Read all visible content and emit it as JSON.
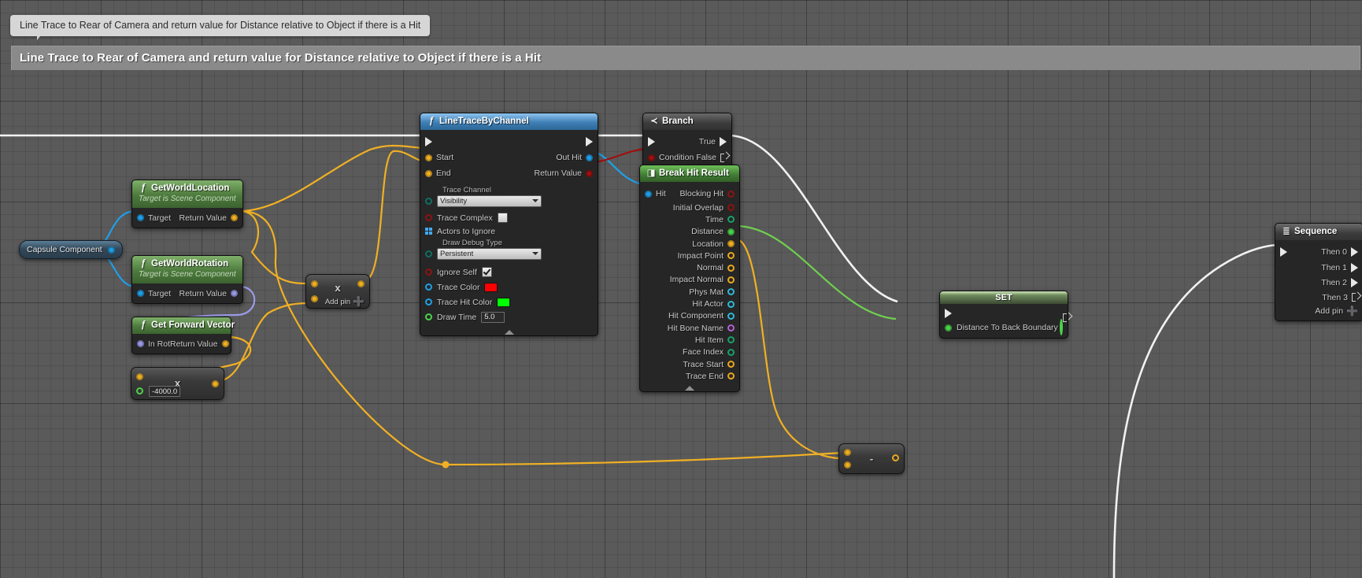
{
  "comment": {
    "bubble_text": "Line Trace to Rear of Camera and return value for Distance relative to Object if there is a Hit",
    "bar_text": "Line Trace to Rear of Camera and return value for Distance relative to Object if there is a Hit"
  },
  "nodes": {
    "capsule": {
      "label": "Capsule Component"
    },
    "get_world_location": {
      "title": "GetWorldLocation",
      "subtitle": "Target is Scene Component",
      "icon": "function-icon",
      "in_target": "Target",
      "out_return": "Return Value"
    },
    "get_world_rotation": {
      "title": "GetWorldRotation",
      "subtitle": "Target is Scene Component",
      "icon": "function-icon",
      "in_target": "Target",
      "out_return": "Return Value"
    },
    "get_forward_vector": {
      "title": "Get Forward Vector",
      "icon": "function-icon",
      "in_rot": "In Rot",
      "out_return": "Return Value"
    },
    "literal_float": {
      "value": "-4000.0",
      "operator": "x"
    },
    "multiply": {
      "operator": "x",
      "add_pin": "Add pin"
    },
    "subtract": {
      "operator": "-"
    },
    "line_trace": {
      "title": "LineTraceByChannel",
      "icon": "function-icon",
      "inputs": {
        "start": "Start",
        "end": "End",
        "trace_channel_label": "Trace Channel",
        "trace_channel_value": "Visibility",
        "trace_complex": "Trace Complex",
        "trace_complex_checked": false,
        "actors_to_ignore": "Actors to Ignore",
        "draw_debug_type_label": "Draw Debug Type",
        "draw_debug_type_value": "Persistent",
        "ignore_self": "Ignore Self",
        "ignore_self_checked": true,
        "trace_color": "Trace Color",
        "trace_color_value": "#ff0000",
        "trace_hit_color": "Trace Hit Color",
        "trace_hit_color_value": "#00ff00",
        "draw_time": "Draw Time",
        "draw_time_value": "5.0"
      },
      "outputs": {
        "out_hit": "Out Hit",
        "return_value": "Return Value"
      }
    },
    "branch": {
      "title": "Branch",
      "icon": "branch-icon",
      "condition": "Condition",
      "true_label": "True",
      "false_label": "False"
    },
    "break_hit_result": {
      "title": "Break Hit Result",
      "icon": "break-struct-icon",
      "input": "Hit",
      "outputs": [
        {
          "label": "Blocking Hit",
          "color": "#8e1212",
          "style": "hollow"
        },
        {
          "label": "Initial Overlap",
          "color": "#8e1212",
          "style": "hollow"
        },
        {
          "label": "Time",
          "color": "#19a06b",
          "style": "hollow"
        },
        {
          "label": "Distance",
          "color": "#4bd44b",
          "style": "solid"
        },
        {
          "label": "Location",
          "color": "#f0b024",
          "style": "solid"
        },
        {
          "label": "Impact Point",
          "color": "#e8a81c",
          "style": "hollow"
        },
        {
          "label": "Normal",
          "color": "#e8a81c",
          "style": "hollow"
        },
        {
          "label": "Impact Normal",
          "color": "#e8a81c",
          "style": "hollow"
        },
        {
          "label": "Phys Mat",
          "color": "#2eb8d8",
          "style": "hollow"
        },
        {
          "label": "Hit Actor",
          "color": "#2eb8d8",
          "style": "hollow"
        },
        {
          "label": "Hit Component",
          "color": "#2eb8d8",
          "style": "hollow"
        },
        {
          "label": "Hit Bone Name",
          "color": "#b45fd6",
          "style": "hollow"
        },
        {
          "label": "Hit Item",
          "color": "#19a06b",
          "style": "hollow"
        },
        {
          "label": "Face Index",
          "color": "#19a06b",
          "style": "hollow"
        },
        {
          "label": "Trace Start",
          "color": "#e8a81c",
          "style": "hollow"
        },
        {
          "label": "Trace End",
          "color": "#e8a81c",
          "style": "hollow"
        }
      ]
    },
    "set_node": {
      "title": "SET",
      "variable": "Distance To Back Boundary"
    },
    "sequence": {
      "title": "Sequence",
      "icon": "sequence-icon",
      "outputs": [
        "Then 0",
        "Then 1",
        "Then 2",
        "Then 3"
      ],
      "add_pin": "Add pin"
    }
  }
}
